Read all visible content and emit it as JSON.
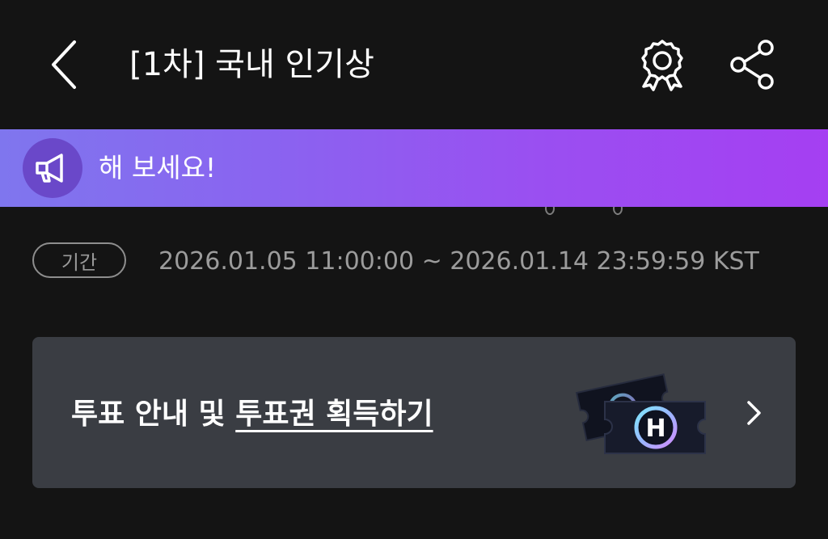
{
  "header": {
    "title": "[1차] 국내 인기상",
    "back_icon": "chevron-left-icon",
    "award_icon": "award-ribbon-icon",
    "share_icon": "share-icon"
  },
  "notice": {
    "text": "해 보세요!",
    "icon": "megaphone-icon",
    "gradient_start": "#7f76ee",
    "gradient_end": "#a53ff2"
  },
  "period": {
    "label": "기간",
    "value": "2026.01.05 11:00:00 ~ 2026.01.14 23:59:59 KST"
  },
  "vote_guide": {
    "text_plain": "투표 안내 및 ",
    "text_link": "투표권 획득하기",
    "ticket_letter": "H",
    "chevron_icon": "chevron-right-icon",
    "background": "#3a3d43"
  },
  "colors": {
    "background": "#141414",
    "text_primary": "#ffffff",
    "text_secondary": "#9c9c9c"
  }
}
